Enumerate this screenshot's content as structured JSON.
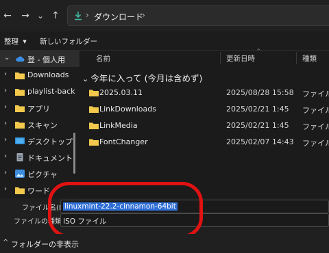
{
  "nav": {
    "back": "←",
    "forward": "→",
    "history": "⌄",
    "up": "↑"
  },
  "address": {
    "separator": "›",
    "location": "ダウンロード",
    "trailing": "›"
  },
  "toolbar": {
    "organize": "整理",
    "organize_chevron": "▾",
    "new_folder": "新しいフォルダー"
  },
  "sidebar": {
    "items": [
      {
        "chevron": "⌄",
        "icon": "cloud-icon",
        "label": "登 - 個人用"
      },
      {
        "chevron": "›",
        "icon": "folder-icon",
        "label": "Downloads"
      },
      {
        "chevron": "›",
        "icon": "folder-icon",
        "label": "playlist-back"
      },
      {
        "chevron": "›",
        "icon": "folder-icon",
        "label": "アプリ"
      },
      {
        "chevron": "›",
        "icon": "folder-icon",
        "label": "スキャン"
      },
      {
        "chevron": "›",
        "icon": "desktop-icon",
        "label": "デスクトップ"
      },
      {
        "chevron": "›",
        "icon": "document-icon",
        "label": "ドキュメント"
      },
      {
        "chevron": "›",
        "icon": "picture-icon",
        "label": "ピクチャ"
      },
      {
        "chevron": "›",
        "icon": "folder-icon",
        "label": "ワード"
      }
    ]
  },
  "columns": {
    "name": "名前",
    "modified": "更新日時",
    "type": "種類",
    "sort_indicator": "^"
  },
  "group": {
    "chevron": "⌄",
    "title": "今年に入って (今月は含めず)"
  },
  "files": [
    {
      "name": "2025.03.11",
      "modified": "2025/08/28 15:58",
      "type": "ファイル"
    },
    {
      "name": "LinkDownloads",
      "modified": "2025/02/21 1:45",
      "type": "ファイル"
    },
    {
      "name": "LinkMedia",
      "modified": "2025/02/21 1:45",
      "type": "ファイル"
    },
    {
      "name": "FontChanger",
      "modified": "2025/02/07 14:43",
      "type": "ファイル"
    }
  ],
  "form": {
    "filename_label": "ファイル名(N):",
    "filename_value": "linuxmint-22.2-cinnamon-64bit",
    "filetype_label": "ファイルの種類(T):",
    "filetype_value": "ISO ファイル"
  },
  "footer": {
    "chevron": "^",
    "hide_folders": "フォルダーの非表示"
  },
  "colors": {
    "accent": "#2f6fd6",
    "folder": "#f2c94c",
    "annotation": "#e01212"
  }
}
